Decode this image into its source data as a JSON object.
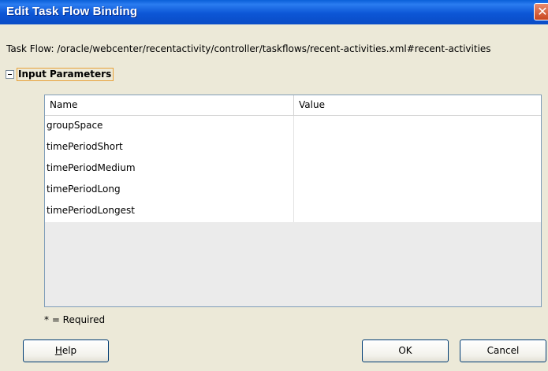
{
  "window": {
    "title": "Edit Task Flow Binding",
    "close_glyph": "✕"
  },
  "task_flow": {
    "label": "Task Flow:",
    "path": "/oracle/webcenter/recentactivity/controller/taskflows/recent-activities.xml#recent-activities"
  },
  "section": {
    "title": "Input Parameters"
  },
  "table": {
    "headers": {
      "name": "Name",
      "value": "Value"
    },
    "rows": [
      {
        "name": "groupSpace",
        "value": ""
      },
      {
        "name": "timePeriodShort",
        "value": ""
      },
      {
        "name": "timePeriodMedium",
        "value": ""
      },
      {
        "name": "timePeriodLong",
        "value": ""
      },
      {
        "name": "timePeriodLongest",
        "value": ""
      }
    ]
  },
  "required_note": "* = Required",
  "buttons": {
    "help_mnemonic": "H",
    "help_rest": "elp",
    "ok": "OK",
    "cancel": "Cancel"
  }
}
